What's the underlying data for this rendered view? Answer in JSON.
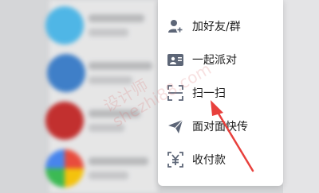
{
  "menu": {
    "items": [
      {
        "label": "加好友/群",
        "icon": "add-friend-icon"
      },
      {
        "label": "一起派对",
        "icon": "party-icon"
      },
      {
        "label": "扫一扫",
        "icon": "scan-icon"
      },
      {
        "label": "面对面快传",
        "icon": "send-icon"
      },
      {
        "label": "收付款",
        "icon": "payment-icon"
      }
    ]
  },
  "watermark": {
    "line1": "设计师",
    "line2": "shezhi88.com"
  },
  "colors": {
    "icon": "#5d6677",
    "arrow": "#e8403c",
    "menu_bg": "#ffffff"
  }
}
